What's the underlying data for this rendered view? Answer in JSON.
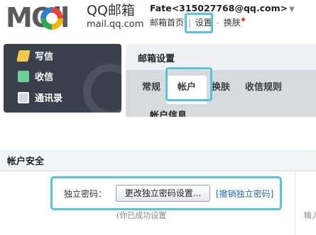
{
  "header": {
    "logo_text": "MOil",
    "brand_name": "QQ邮箱",
    "brand_url": "mail.qq.com",
    "user_line": "Fate<315027768@qq.com>",
    "user_menu_arrow": "▼",
    "links": {
      "home": "邮箱首页",
      "separator": "|",
      "settings": "设置",
      "dash": "-",
      "skin": "换肤"
    }
  },
  "sidebar": {
    "items": [
      {
        "label": "写信",
        "icon": "pencil-icon"
      },
      {
        "label": "收信",
        "icon": "download-icon"
      },
      {
        "label": "通讯录",
        "icon": "contact-card-icon"
      }
    ]
  },
  "settings": {
    "title": "邮箱设置",
    "tabs": [
      {
        "label": "常规",
        "active": false
      },
      {
        "label": "帐户",
        "active": true
      },
      {
        "label": "换肤",
        "active": false
      },
      {
        "label": "收信规则",
        "active": false
      }
    ],
    "section_cut": "帐户信息"
  },
  "account_security": {
    "title": "帐户安全",
    "password_label": "独立密码：",
    "change_button": "更改独立密码设置...",
    "revoke_link": "[撤销独立密码]",
    "note": "(你已成功设置",
    "right_cut": "输入"
  },
  "colors": {
    "highlight": "#58c4d6",
    "sidebar_bg": "#3a414c",
    "link_blue": "#2b6cb3",
    "notice_dot": "#e2462c"
  }
}
